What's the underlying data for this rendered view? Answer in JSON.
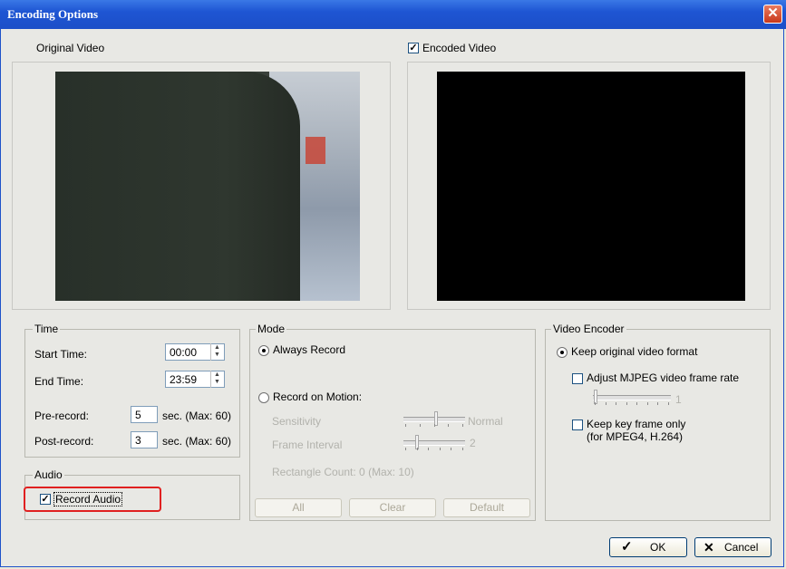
{
  "window": {
    "title": "Encoding Options"
  },
  "original_video": {
    "label": "Original Video"
  },
  "encoded_video": {
    "label": "Encoded Video",
    "checked": true
  },
  "time": {
    "group_title": "Time",
    "start_label": "Start Time:",
    "start_value": "00:00",
    "end_label": "End Time:",
    "end_value": "23:59",
    "prerecord_label": "Pre-record:",
    "prerecord_value": "5",
    "prerecord_suffix": "sec. (Max: 60)",
    "postrecord_label": "Post-record:",
    "postrecord_value": "3",
    "postrecord_suffix": "sec. (Max: 60)"
  },
  "audio": {
    "group_title": "Audio",
    "record_label": "Record Audio",
    "checked": true,
    "highlight_color": "#e02020"
  },
  "mode": {
    "group_title": "Mode",
    "always_record": "Always Record",
    "record_on_motion": "Record on Motion:",
    "sensitivity_label": "Sensitivity",
    "sensitivity_value": "Normal",
    "frame_interval_label": "Frame Interval",
    "frame_interval_value": "2",
    "rectangle_count": "Rectangle Count: 0  (Max: 10)",
    "buttons": {
      "all": "All",
      "clear": "Clear",
      "default": "Default"
    }
  },
  "video_encoder": {
    "group_title": "Video Encoder",
    "keep_original": "Keep original video format",
    "adjust_mjpeg": "Adjust MJPEG video frame rate",
    "frame_rate_value": "1",
    "keep_key_frame": "Keep key frame only",
    "keep_key_frame_note": "(for MPEG4, H.264)"
  },
  "footer": {
    "ok": "OK",
    "cancel": "Cancel"
  },
  "colors": {
    "title_bar": "#1e55d3",
    "encoded_preview": "#000000"
  }
}
